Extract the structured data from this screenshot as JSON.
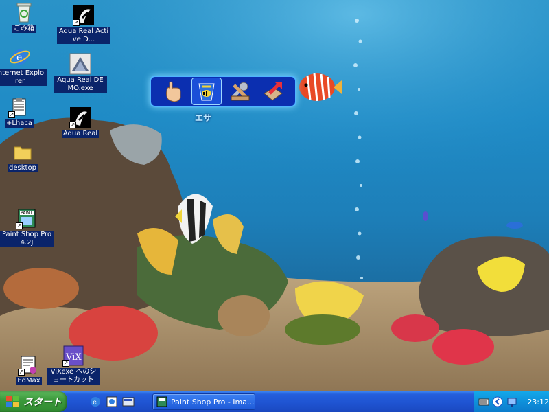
{
  "desktop_icons": [
    {
      "id": "recycle",
      "label": "ごみ箱",
      "icon": "recycle-bin-icon",
      "shortcut": false
    },
    {
      "id": "ie",
      "label": "Internet Explorer",
      "icon": "internet-explorer-icon",
      "shortcut": false
    },
    {
      "id": "lhaca",
      "label": "+Lhaca",
      "icon": "lhaca-archiver-icon",
      "shortcut": true
    },
    {
      "id": "desktop",
      "label": "desktop",
      "icon": "folder-icon",
      "shortcut": false
    },
    {
      "id": "psp",
      "label": "Paint Shop Pro 4.2J",
      "icon": "paint-shop-pro-icon",
      "shortcut": true
    },
    {
      "id": "edmax",
      "label": "EdMax",
      "icon": "edmax-mail-icon",
      "shortcut": true
    },
    {
      "id": "vix",
      "label": "ViXexe へのショートカット",
      "icon": "vix-viewer-icon",
      "shortcut": true
    },
    {
      "id": "aqua-active",
      "label": "Aqua Real Active D...",
      "icon": "aqua-real-fish-icon",
      "shortcut": true
    },
    {
      "id": "aqua-demo",
      "label": "Aqua Real DEMO.exe",
      "icon": "aqua-real-demo-icon",
      "shortcut": false
    },
    {
      "id": "aqua-real",
      "label": "Aqua Real",
      "icon": "aqua-real-fish-icon",
      "shortcut": true
    }
  ],
  "tool_palette": {
    "caption": "エサ",
    "tools": [
      {
        "id": "hand",
        "icon": "hand-pointer-icon"
      },
      {
        "id": "feed",
        "icon": "fish-food-icon"
      },
      {
        "id": "settings",
        "icon": "tools-wrench-icon"
      },
      {
        "id": "exit",
        "icon": "exit-arrow-icon"
      }
    ]
  },
  "taskbar": {
    "start_label": "スタート",
    "task_title": "Paint Shop Pro - Ima...",
    "clock": "23:12",
    "quicklaunch": [
      "internet-explorer-icon",
      "edmax-icon",
      "show-desktop-icon"
    ],
    "tray": [
      "keyboard-icon",
      "expand-chevron-icon",
      "network-icon"
    ]
  },
  "colors": {
    "water_top": "#2a93c8",
    "selection_blue": "#0a246a",
    "taskbar_blue": "#245edb",
    "start_green": "#3c9a3c"
  }
}
